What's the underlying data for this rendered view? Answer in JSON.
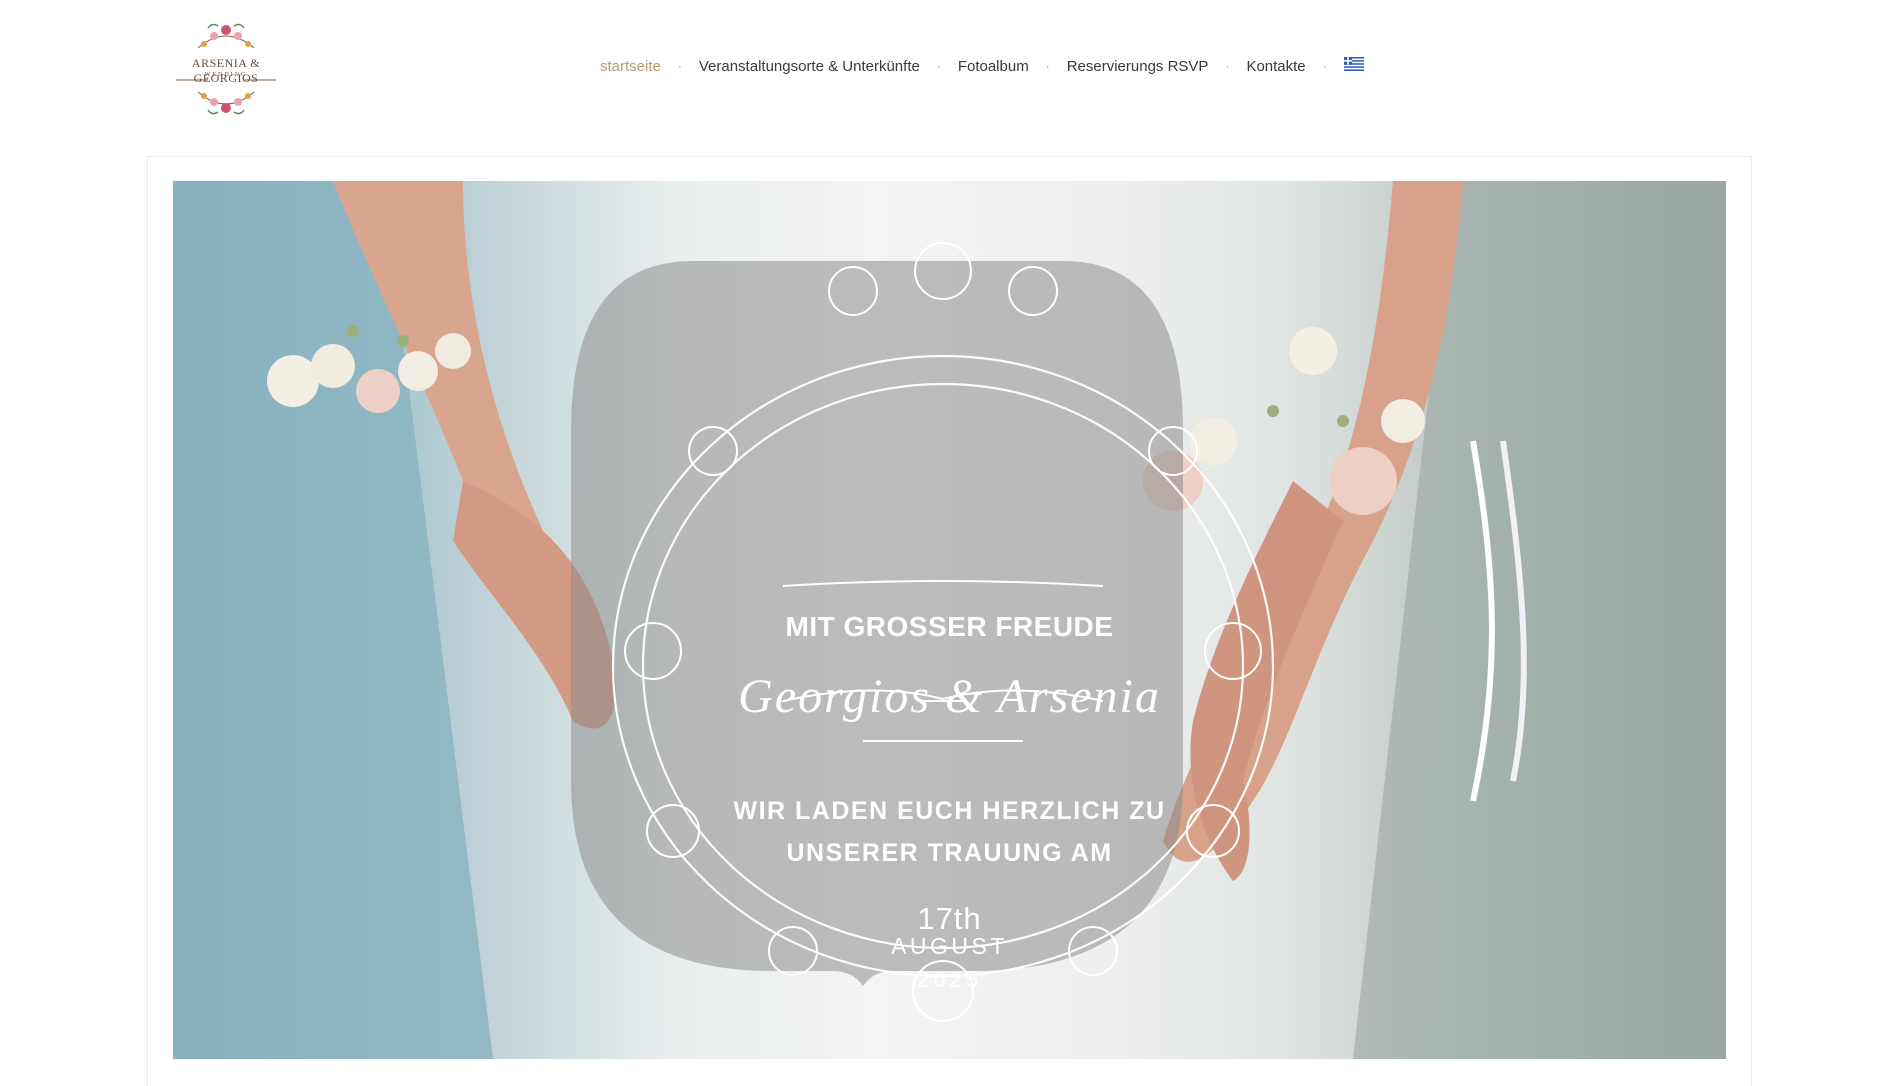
{
  "logo": {
    "title": "ARSENIA & GEORGIOS",
    "subtitle": "WEDDING"
  },
  "nav": {
    "items": [
      {
        "label": "startseite",
        "active": true
      },
      {
        "label": "Veranstaltungsorte & Unterkünfte",
        "active": false
      },
      {
        "label": "Fotoalbum",
        "active": false
      },
      {
        "label": "Reservierungs RSVP",
        "active": false
      },
      {
        "label": "Kontakte",
        "active": false
      }
    ],
    "separator": "·",
    "language_icon": "greek-flag-icon"
  },
  "hero": {
    "line1": "MIT GROSSER FREUDE",
    "names": "Georgios & Arsenia",
    "invite_line1": "WIR LADEN EUCH HERZLICH ZU",
    "invite_line2": "UNSERER TRAUUNG AM",
    "day": "17th",
    "month": "AUGUST",
    "year": "2025",
    "image": "wedding-hands-with-floral-wrist-corsages"
  },
  "colors": {
    "accent": "#b49b6e",
    "nav_text": "#3a3a3a",
    "overlay": "#8c8c8c"
  }
}
